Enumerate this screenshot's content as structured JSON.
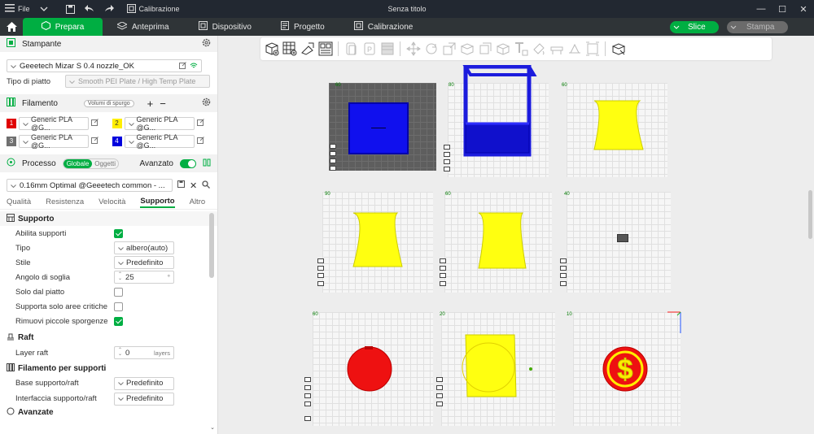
{
  "titlebar": {
    "file_label": "File",
    "calibration_label": "Calibrazione",
    "window_title": "Senza titolo"
  },
  "tabs": [
    {
      "label": "Prepara"
    },
    {
      "label": "Anteprima"
    },
    {
      "label": "Dispositivo"
    },
    {
      "label": "Progetto"
    },
    {
      "label": "Calibrazione"
    }
  ],
  "actions": {
    "slice_label": "Slice",
    "print_label": "Stampa"
  },
  "printer": {
    "section_title": "Stampante",
    "name": "Geeetech Mizar S 0.4 nozzle_OK",
    "plate_type_label": "Tipo di piatto",
    "plate_type_value": "Smooth PEI Plate / High Temp Plate"
  },
  "filament": {
    "section_title": "Filamento",
    "purge_button": "Volumi di spurgo",
    "slots": [
      {
        "index": "1",
        "color": "#e00000",
        "name": "Generic PLA @G..."
      },
      {
        "index": "2",
        "color": "#ffee00",
        "name": "Generic PLA @G..."
      },
      {
        "index": "3",
        "color": "#707070",
        "name": "Generic PLA @G..."
      },
      {
        "index": "4",
        "color": "#0000dd",
        "name": "Generic PLA @G..."
      }
    ]
  },
  "process": {
    "section_title": "Processo",
    "global_label": "Globale",
    "objects_label": "Oggetti",
    "advanced_label": "Avanzato",
    "preset": "0.16mm Optimal @Geeetech common - ...",
    "subtabs": [
      "Qualità",
      "Resistenza",
      "Velocità",
      "Supporto",
      "Altro"
    ],
    "active_subtab": "Supporto"
  },
  "settings": {
    "support_group": "Supporto",
    "enable_support": "Abilita supporti",
    "type_label": "Tipo",
    "type_value": "albero(auto)",
    "style_label": "Stile",
    "style_value": "Predefinito",
    "angle_label": "Angolo di soglia",
    "angle_value": "25",
    "angle_unit": "°",
    "build_plate_only": "Solo dal piatto",
    "critical_only": "Supporta solo aree critiche",
    "remove_small": "Rimuovi piccole sporgenze",
    "raft_group": "Raft",
    "raft_layers_label": "Layer raft",
    "raft_layers_value": "0",
    "raft_layers_unit": "layers",
    "filament_group": "Filamento per supporti",
    "base_label": "Base supporto/raft",
    "base_value": "Predefinito",
    "interface_label": "Interfaccia supporto/raft",
    "interface_value": "Predefinito",
    "advanced_group": "Avanzate"
  },
  "plates": [
    {
      "label": "60"
    },
    {
      "label": "80"
    },
    {
      "label": "60"
    },
    {
      "label": "90"
    },
    {
      "label": "60"
    },
    {
      "label": "40"
    },
    {
      "label": "60"
    },
    {
      "label": "20"
    },
    {
      "label": "10"
    }
  ],
  "colors": {
    "accent": "#00ae42",
    "titlebar": "#222831",
    "tabbar": "#2f3437"
  }
}
